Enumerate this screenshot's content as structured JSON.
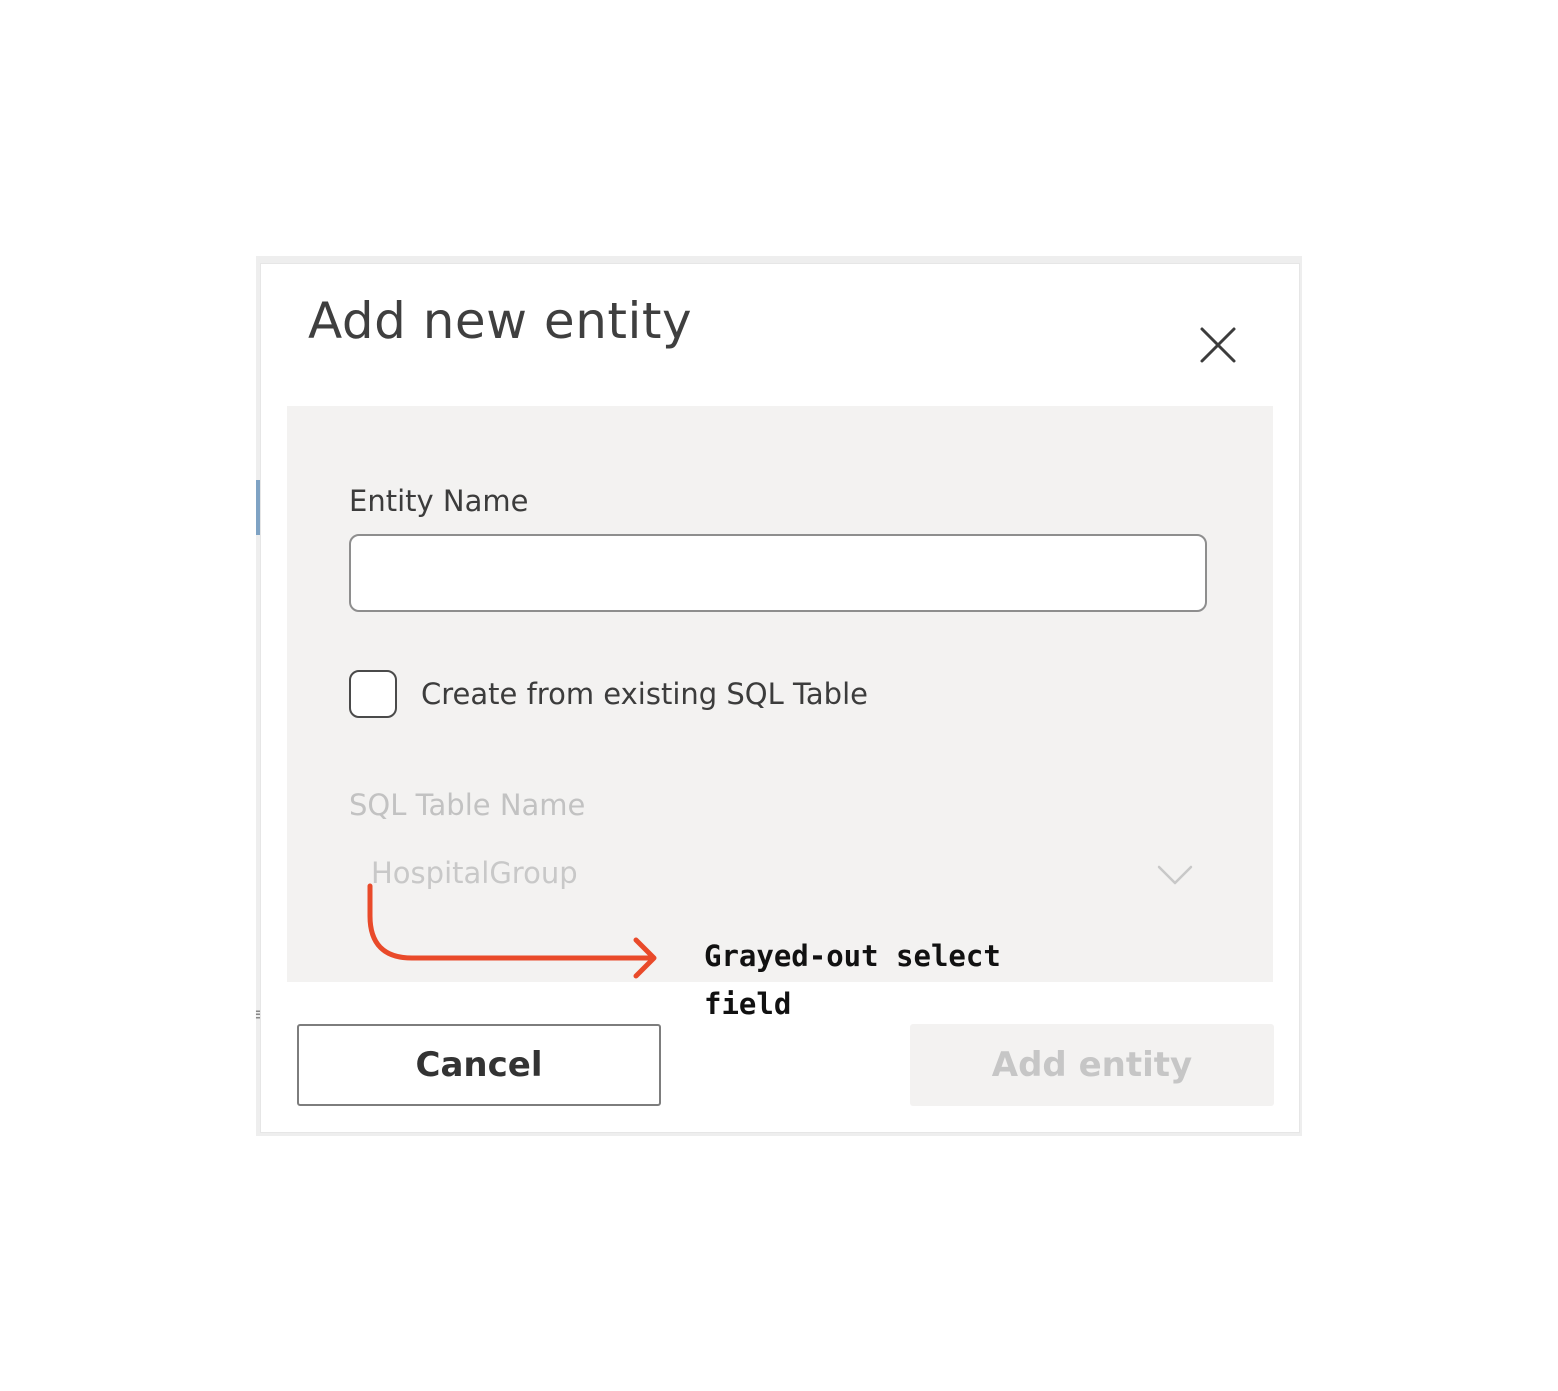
{
  "dialog": {
    "title": "Add new entity",
    "close_icon": "close-icon"
  },
  "form": {
    "entity_name_label": "Entity Name",
    "entity_name_value": "",
    "checkbox_label": "Create from existing SQL Table",
    "checkbox_checked": false,
    "sql_table_label": "SQL Table Name",
    "sql_table_value": "HospitalGroup",
    "sql_table_disabled": true,
    "chevron_icon": "chevron-down-icon"
  },
  "actions": {
    "cancel_label": "Cancel",
    "add_label": "Add entity",
    "add_disabled": true
  },
  "annotation": {
    "text": "Grayed-out select field",
    "color": "#e94a2a"
  },
  "colors": {
    "panel_bg": "#f3f2f1",
    "disabled_text": "#c6c6c6",
    "accent_strip": "#7fa3c4"
  }
}
